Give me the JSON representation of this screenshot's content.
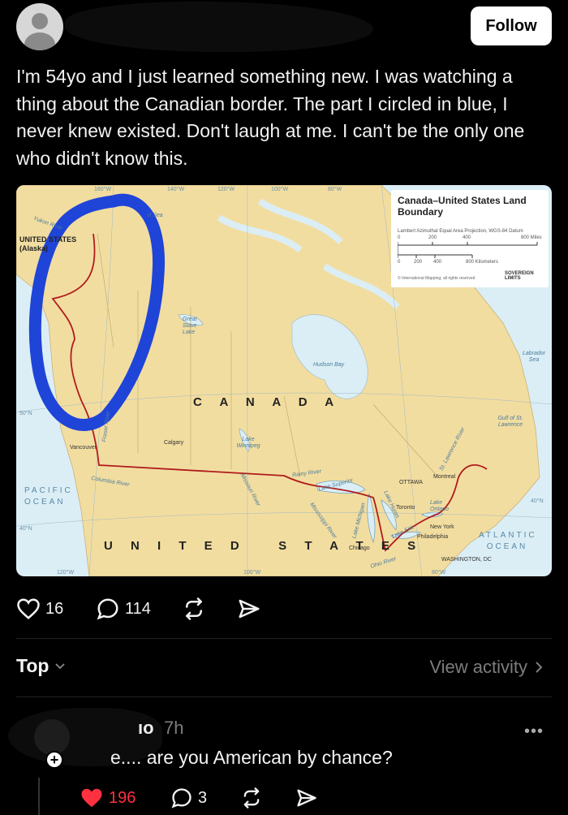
{
  "post": {
    "follow_label": "Follow",
    "text": "I'm 54yo and I just learned something new. I was watching a thing about the Canadian border. The part I circled in blue,  I never knew existed.  Don't laugh at me. I can't be the only one who didn't know this.",
    "likes": "16",
    "replies": "114"
  },
  "map": {
    "title": "Canada–United States Land Boundary",
    "subtitle": "Lambert Azimuthal Equal Area Projection, WGS-84 Datum",
    "credit": "© International Mapping; all rights reserved",
    "logo": "SOVEREIGN LIMITS",
    "scale_miles": [
      "0",
      "200",
      "400",
      "800 Miles"
    ],
    "scale_km": [
      "0",
      "200",
      "400",
      "800 Kilometers"
    ],
    "country_canada": "C A N A D A",
    "country_us": "U N I T E D   S T A T E S",
    "alaska": "UNITED STATES (Alaska)",
    "pacific": "PACIFIC OCEAN",
    "atlantic": "ATLANTIC OCEAN",
    "water_labels": {
      "hudson_bay": "Hudson Bay",
      "great_slave_lake": "Great Slave Lake",
      "lake_winnipeg": "Lake Winnipeg",
      "lake_superior": "Lake Superior",
      "lake_michigan": "Lake Michigan",
      "lake_huron": "Lake Huron",
      "lake_erie": "Lake Erie",
      "lake_ontario": "Lake Ontario",
      "labrador_sea": "Labrador Sea",
      "gulf_st_lawrence": "Gulf of St. Lawrence",
      "st_lawrence_river": "St. Lawrence River",
      "rainy_river": "Rainy River",
      "columbia_river": "Columbia River",
      "fraser_river": "Fraser River",
      "ohio_river": "Ohio River",
      "mississippi_river": "Mississippi River",
      "missouri_river": "Missouri River",
      "yukon_river": "Yukon River",
      "beaufort_sea": "rt Sea"
    },
    "cities": {
      "vancouver": "Vancouver",
      "calgary": "Calgary",
      "toronto": "Toronto",
      "ottawa": "OTTAWA",
      "montreal": "Montreal",
      "new_york": "New York",
      "philadelphia": "Philadelphia",
      "washington": "WASHINGTON, DC",
      "chicago": "Chicago"
    },
    "graticule": [
      "160°W",
      "140°W",
      "120°W",
      "100°W",
      "80°W",
      "120°W",
      "100°W",
      "80°W",
      "50°N",
      "40°N",
      "40°N"
    ],
    "circle_color": "#1f44d8",
    "border_color": "#b01c1c",
    "land_color": "#f2dda0",
    "water_color": "#dbeef5"
  },
  "sort": {
    "label": "Top",
    "view_activity": "View activity"
  },
  "comment": {
    "user": "ıo",
    "time": "7h",
    "text": "e.... are you American by chance?",
    "likes": "196",
    "replies": "3"
  },
  "icons": [
    "heart-icon",
    "comment-icon",
    "repost-icon",
    "share-icon",
    "chevron-down-icon",
    "chevron-right-icon",
    "more-icon",
    "plus-icon"
  ]
}
